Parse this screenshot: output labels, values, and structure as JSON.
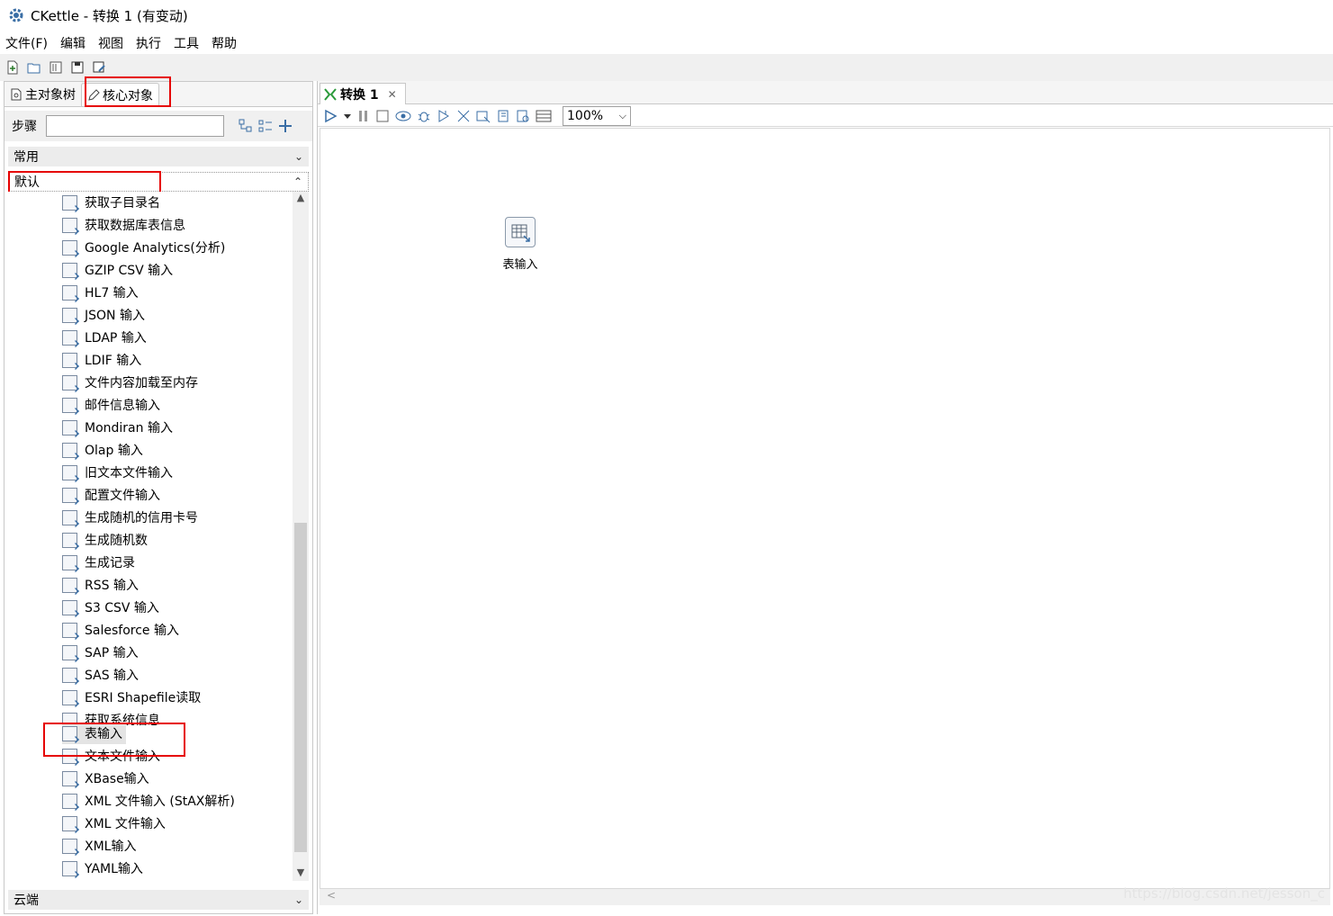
{
  "window": {
    "title": "CKettle - 转换 1 (有变动)"
  },
  "menu": [
    "文件(F)",
    "编辑",
    "视图",
    "执行",
    "工具",
    "帮助"
  ],
  "left_tabs": {
    "main_tree": "主对象树",
    "core_objects": "核心对象"
  },
  "search": {
    "label": "步骤",
    "value": ""
  },
  "categories": {
    "common": "常用",
    "default": "默认",
    "cloud": "云端"
  },
  "steps": [
    "获取子目录名",
    "获取数据库表信息",
    "Google Analytics(分析)",
    "GZIP CSV 输入",
    "HL7 输入",
    "JSON 输入",
    "LDAP 输入",
    "LDIF 输入",
    "文件内容加载至内存",
    "邮件信息输入",
    "Mondiran 输入",
    "Olap 输入",
    "旧文本文件输入",
    "配置文件输入",
    "生成随机的信用卡号",
    "生成随机数",
    "生成记录",
    "RSS 输入",
    "S3 CSV 输入",
    "Salesforce 输入",
    "SAP 输入",
    "SAS 输入",
    "ESRI Shapefile读取",
    "获取系统信息",
    "表输入",
    "文本文件输入",
    "XBase输入",
    "XML 文件输入 (StAX解析)",
    "XML 文件输入",
    "XML输入",
    "YAML输入"
  ],
  "selected_step": "表输入",
  "editor": {
    "tab_label": "转换 1",
    "zoom": "100%",
    "canvas_step_label": "表输入",
    "watermark": "https://blog.csdn.net/jesson_c"
  }
}
